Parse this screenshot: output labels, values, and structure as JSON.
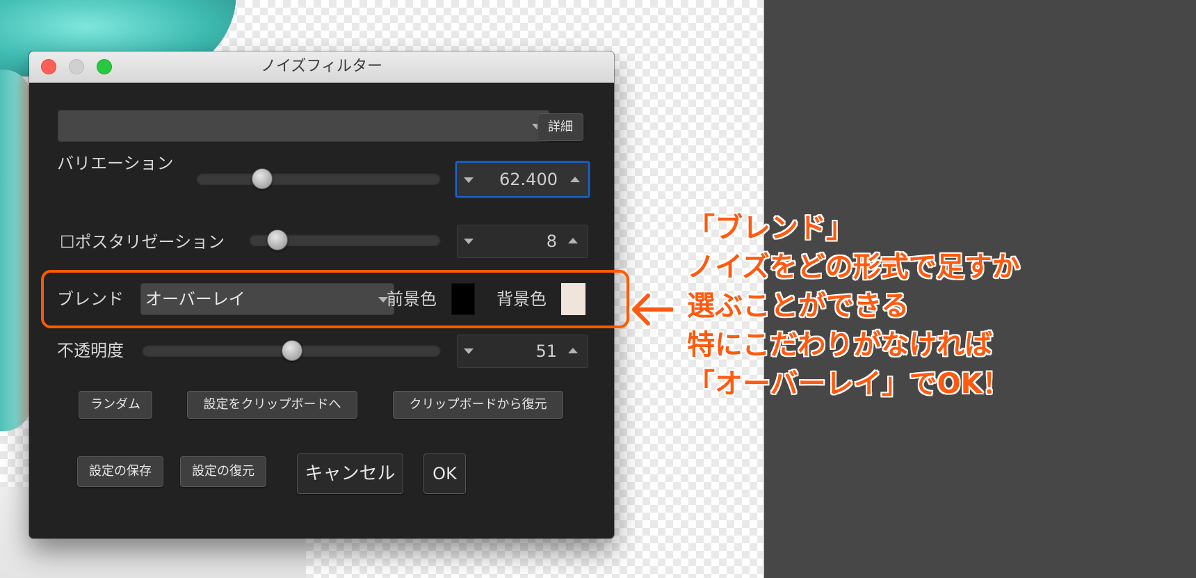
{
  "dialog": {
    "title": "ノイズフィルター",
    "details_button": "詳細",
    "preset_value": ""
  },
  "variation": {
    "label": "バリエーション",
    "value": "62.400",
    "slider_fraction": 0.27
  },
  "posterization": {
    "checkbox": "☐",
    "label": "ポスタリゼーション",
    "value": "8",
    "checked": false,
    "slider_fraction": 0.15
  },
  "blend": {
    "label": "ブレンド",
    "selected": "オーバーレイ",
    "foreground_label": "前景色",
    "background_label": "背景色",
    "foreground_color": "#000000",
    "background_color": "#efe5dc"
  },
  "opacity": {
    "label": "不透明度",
    "value": "51",
    "slider_fraction": 0.51
  },
  "buttons": {
    "random": "ランダム",
    "copy_to_clipboard": "設定をクリップボードへ",
    "restore_from_clipboard": "クリップボードから復元",
    "save_settings": "設定の保存",
    "restore_settings": "設定の復元",
    "cancel": "キャンセル",
    "ok": "OK"
  },
  "annotation": {
    "lines": [
      "「ブレンド」",
      "ノイズをどの形式で足すか",
      "選ぶことができる",
      "特にこだわりがなければ",
      "「オーバーレイ」でOK！"
    ],
    "color": "#ff5a0f"
  }
}
